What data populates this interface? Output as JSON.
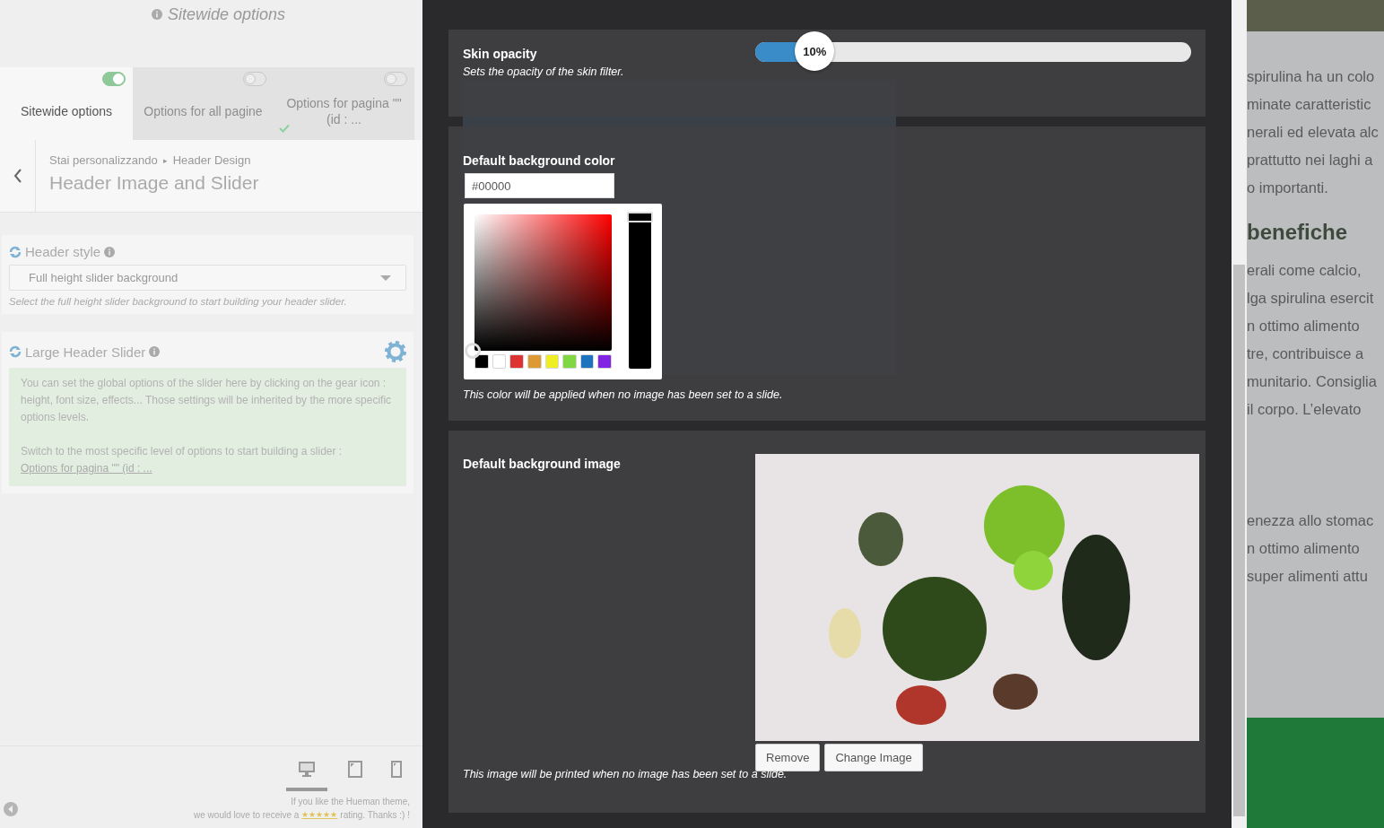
{
  "customizer": {
    "heading": "Sitewide options",
    "scopes": [
      {
        "label": "Sitewide options",
        "selected": true,
        "on": true,
        "checked": false
      },
      {
        "label": "Options for all pagine",
        "selected": false,
        "on": false,
        "checked": false
      },
      {
        "label": "Options for pagina \"\" (id : ...",
        "selected": false,
        "on": false,
        "checked": true
      }
    ],
    "breadcrumb": {
      "trail": [
        "Stai personalizzando",
        "Header Design"
      ],
      "separator": "▸",
      "title": "Header Image and Slider"
    },
    "controls": [
      {
        "kind": "select",
        "title": "Header style",
        "value": "Full height slider background",
        "note": "Select the full height slider background to start building your header slider."
      },
      {
        "kind": "notice",
        "title": "Large Header Slider",
        "paragraphs": [
          "You can set the global options of the slider here by clicking on the gear icon : height, font size, effects... Those settings will be inherited by the more specific options levels.",
          "Switch to the most specific level of options to start building a slider :"
        ],
        "link": "Options for pagina \"\" (id : ..."
      }
    ],
    "devices": [
      {
        "kind": "desktop",
        "selected": true
      },
      {
        "kind": "tablet",
        "selected": false
      },
      {
        "kind": "mobile",
        "selected": false
      }
    ],
    "rating": {
      "line_1": "If you like the Hueman theme,",
      "before": "we would love to receive a",
      "stars": "★★★★★",
      "after": "rating. Thanks :) !"
    }
  },
  "modal": {
    "sections": [
      {
        "kind": "slider",
        "label": "Skin opacity",
        "level": 0.1,
        "reading": "10%",
        "note": "Sets the opacity of the skin filter."
      },
      {
        "kind": "color",
        "label": "Default background color",
        "value": "#00000",
        "swatches": [
          {
            "color": "#000000"
          },
          {
            "color": "#ffffff"
          },
          {
            "color": "#dd3333"
          },
          {
            "color": "#dd9933"
          },
          {
            "color": "#eeee22"
          },
          {
            "color": "#81d742"
          },
          {
            "color": "#1e73be"
          },
          {
            "color": "#8224e3"
          }
        ],
        "note": "This color will be applied when no image has been set to a slide."
      },
      {
        "kind": "image",
        "label": "Default background image",
        "buttons": [
          "Remove",
          "Change Image"
        ],
        "note": "This image will be printed when no image has been set to a slide."
      }
    ]
  },
  "page": {
    "blocks": [
      {
        "kind": "text",
        "lines": [
          "spirulina ha un colo",
          "minate caratteristic",
          "nerali ed elevata alc",
          "prattutto nei laghi a",
          "o importanti."
        ]
      },
      {
        "kind": "heading",
        "lines": [
          "benefiche"
        ]
      },
      {
        "kind": "text",
        "lines": [
          "erali come calcio,",
          "lga spirulina esercit",
          "n ottimo alimento",
          "tre, contribuisce a",
          "munitario. Consiglia",
          "il corpo. L’elevato"
        ]
      },
      {
        "kind": "text",
        "lines": [
          "enezza allo stomac",
          "n ottimo alimento",
          "super alimenti attu"
        ]
      }
    ]
  }
}
